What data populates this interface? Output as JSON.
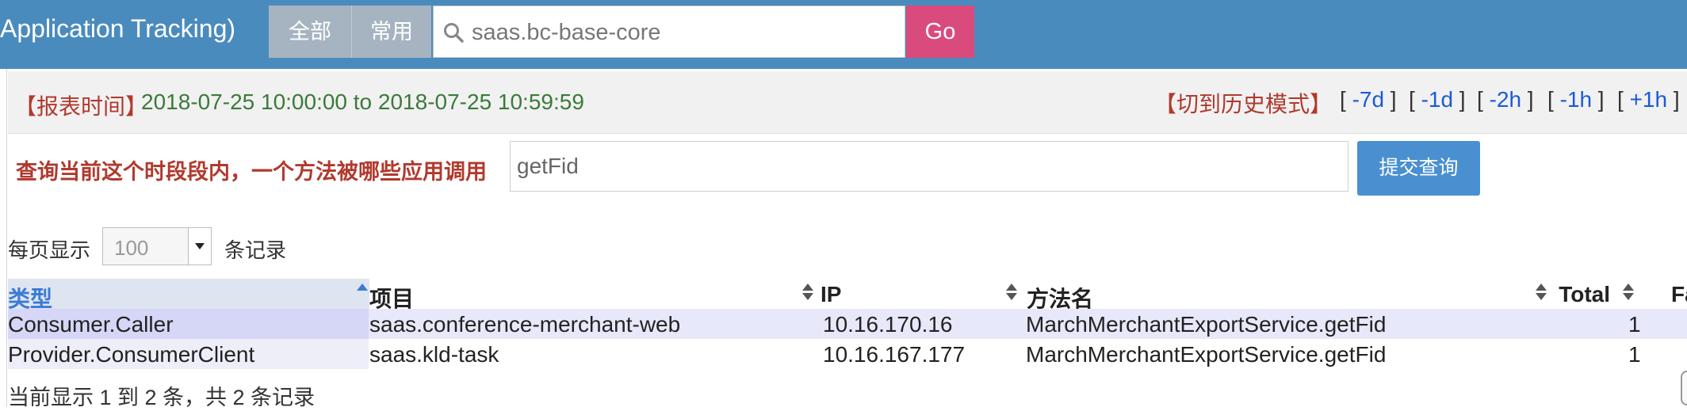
{
  "header": {
    "brand": "Application Tracking)",
    "scope_all": "全部",
    "scope_common": "常用",
    "search_value": "saas.bc-base-core",
    "go_label": "Go"
  },
  "time_bar": {
    "label": "【报表时间】",
    "range": "2018-07-25 10:00:00 to 2018-07-25 10:59:59",
    "history_mode": "【切到历史模式】",
    "nav": [
      "-7d",
      "-1d",
      "-2h",
      "-1h",
      "+1h"
    ]
  },
  "query": {
    "label": "查询当前这个时段段内，一个方法被哪些应用调用",
    "value": "getFid",
    "submit_label": "提交查询"
  },
  "pagination": {
    "prefix": "每页显示",
    "page_size": "100",
    "suffix": "条记录",
    "info": "当前显示 1 到 2 条，共 2 条记录"
  },
  "table": {
    "columns": [
      "类型",
      "项目",
      "IP",
      "方法名",
      "Total",
      "Fa"
    ],
    "rows": [
      [
        "Consumer.Caller",
        "saas.conference-merchant-web",
        "10.16.170.16",
        "MarchMerchantExportService.getFid",
        "1"
      ],
      [
        "Provider.ConsumerClient",
        "saas.kld-task",
        "10.16.167.177",
        "MarchMerchantExportService.getFid",
        "1"
      ]
    ]
  },
  "colors": {
    "topbar": "#4a8bbd",
    "go_button": "#d94b7d",
    "submit_button": "#4a90d0",
    "label_red": "#b03a2e",
    "time_green": "#3c7a3a",
    "link_blue": "#1a5bd6"
  },
  "icons": {
    "search": "search-icon",
    "dropdown": "chevron-down-icon",
    "sort": "sort-icon"
  }
}
